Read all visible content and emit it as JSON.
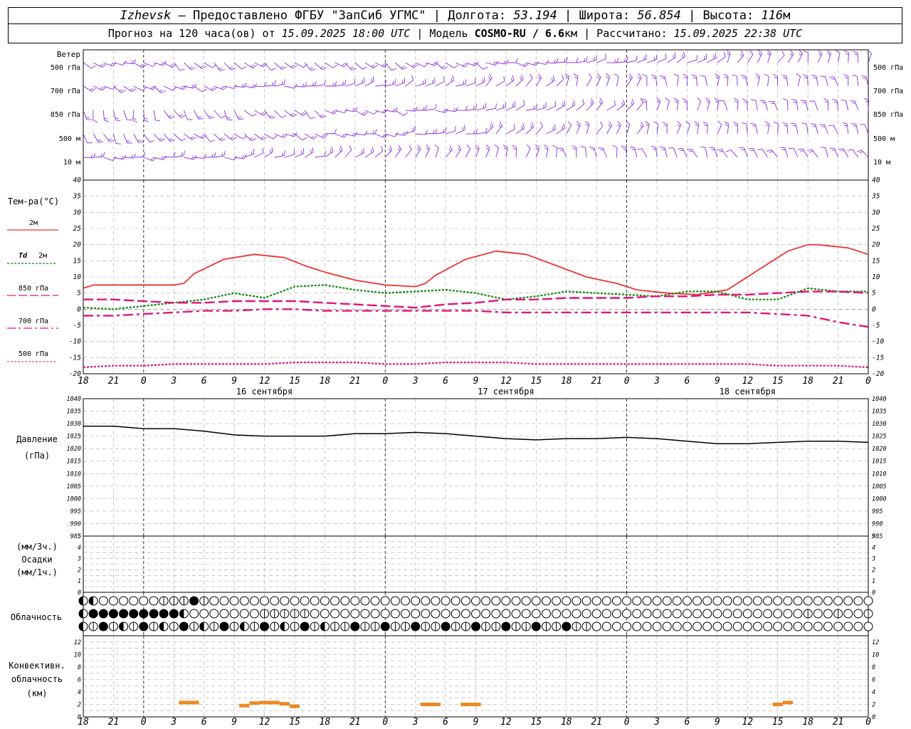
{
  "header": {
    "city": "Izhevsk",
    "provider": "– Предоставлено ФГБУ \"ЗапСиб УГМС\" |",
    "lon_label": "Долгота:",
    "lon": "53.194",
    "lat_label": "| Широта:",
    "lat": "56.854",
    "alt_label": "| Высота:",
    "alt": "116",
    "alt_unit": "м",
    "forecast_prefix": "Прогноз на 120 часа(ов) от",
    "forecast_time": "15.09.2025 18:00 UTC",
    "model_label": "| Модель",
    "model": "COSMO-RU / 6.6",
    "model_unit": "км",
    "calc_label": "| Рассчитано:",
    "calc_time": "15.09.2025 22:38 UTC"
  },
  "labels": {
    "wind": "Ветер",
    "lev500": "500 гПа",
    "lev700": "700 гПа",
    "lev850": "850 гПа",
    "lev500m": "500 м",
    "lev10m": "10  м",
    "temp": "Тем-ра(°C)",
    "t2m": "2м",
    "td": "Td",
    "td_lvl": "2м",
    "t850": "850 гПа",
    "t700": "700 гПа",
    "t500": "500 гПа",
    "pressure1": "Давление",
    "pressure2": "(гПа)",
    "precip1": "(мм/3ч.)",
    "precip2": "Осадки",
    "precip3": "(мм/1ч.)",
    "cloud": "Облачность",
    "conv1": "Конвективн.",
    "conv2": "облачность",
    "conv3": "(км)"
  },
  "colors": {
    "t2m": "#ee3333",
    "td": "#118811",
    "t850": "#e0157a",
    "t700": "#e0157a",
    "t500": "#e0157a",
    "wind": "#8a2be2",
    "pressure": "#000000",
    "conv": "#ee8822",
    "grid": "#aaaaaa"
  },
  "chart_data": [
    {
      "type": "line",
      "panel": "temperature",
      "ylim": [
        -20,
        40
      ],
      "yticks": [
        -20,
        -15,
        -10,
        -5,
        0,
        5,
        10,
        15,
        20,
        25,
        30,
        35,
        40
      ],
      "x_hours_from_start": [
        0,
        3,
        6,
        9,
        12,
        15,
        18,
        21,
        24,
        27,
        30,
        33,
        36,
        39,
        42,
        45,
        48,
        51,
        54,
        57,
        60,
        63,
        66,
        69,
        72,
        75,
        78
      ],
      "x_tick_labels": [
        "18",
        "21",
        "0",
        "3",
        "6",
        "9",
        "12",
        "15",
        "18",
        "21",
        "0",
        "3",
        "6",
        "9",
        "12",
        "15",
        "18",
        "21",
        "0",
        "3",
        "6",
        "9",
        "12",
        "15",
        "18",
        "21",
        "0"
      ],
      "day_labels": [
        {
          "hour": 18,
          "text": "16 сентября"
        },
        {
          "hour": 42,
          "text": "17 сентября"
        },
        {
          "hour": 66,
          "text": "18 сентября"
        }
      ],
      "series": [
        {
          "name": "2м",
          "x": [
            0,
            1,
            3,
            6,
            9,
            10,
            11,
            14,
            17,
            20,
            22,
            24,
            27,
            30,
            33,
            34,
            35,
            38,
            41,
            44,
            47,
            50,
            53,
            54,
            55,
            58,
            61,
            64,
            67,
            70,
            72,
            73,
            76,
            78
          ],
          "values": [
            6.5,
            7.5,
            7.5,
            7.5,
            7.5,
            8,
            11,
            15.5,
            17,
            16,
            13.5,
            11.5,
            9,
            7.5,
            7,
            8,
            10.5,
            15.5,
            18,
            17,
            13.5,
            10,
            8,
            7,
            6,
            5,
            4.5,
            6,
            12,
            18,
            20,
            20,
            19,
            17
          ]
        },
        {
          "name": "Td 2м",
          "x": [
            0,
            3,
            6,
            9,
            12,
            15,
            18,
            21,
            24,
            27,
            30,
            33,
            36,
            39,
            42,
            45,
            48,
            51,
            54,
            57,
            60,
            63,
            66,
            69,
            72,
            75,
            78
          ],
          "values": [
            0.5,
            0,
            1,
            2,
            3,
            5,
            3.5,
            7,
            7.5,
            6,
            5,
            5.5,
            6,
            5,
            3,
            4,
            5.5,
            5,
            4.5,
            4,
            5.5,
            5.5,
            3,
            3,
            6.5,
            5.5,
            5.5
          ]
        },
        {
          "name": "850 гПа",
          "x": [
            0,
            3,
            6,
            9,
            12,
            15,
            18,
            21,
            24,
            27,
            30,
            33,
            36,
            39,
            42,
            45,
            48,
            51,
            54,
            57,
            60,
            63,
            66,
            69,
            72,
            75,
            78
          ],
          "values": [
            3,
            3,
            2.5,
            2,
            2,
            2.5,
            2.5,
            2.5,
            2,
            1.5,
            1,
            0.5,
            1.5,
            2,
            3,
            3,
            3.5,
            3.5,
            3.5,
            4,
            4,
            4.5,
            4.5,
            5,
            5.5,
            5.5,
            5
          ]
        },
        {
          "name": "700 гПа",
          "x": [
            0,
            3,
            6,
            9,
            12,
            15,
            18,
            21,
            24,
            27,
            30,
            33,
            36,
            39,
            42,
            45,
            48,
            51,
            54,
            57,
            60,
            63,
            66,
            69,
            72,
            75,
            78
          ],
          "values": [
            -2,
            -2,
            -1.5,
            -1,
            -0.5,
            -0.5,
            0,
            0,
            -0.5,
            -0.5,
            -0.5,
            -0.5,
            -0.5,
            -0.5,
            -1,
            -1,
            -1,
            -1,
            -1,
            -1,
            -1,
            -1,
            -1,
            -1.5,
            -2,
            -4,
            -5.5
          ]
        },
        {
          "name": "500 гПа",
          "x": [
            0,
            3,
            6,
            9,
            12,
            15,
            18,
            21,
            24,
            27,
            30,
            33,
            36,
            39,
            42,
            45,
            48,
            51,
            54,
            57,
            60,
            63,
            66,
            69,
            72,
            75,
            78
          ],
          "values": [
            -18,
            -17.5,
            -17.5,
            -17,
            -17,
            -17,
            -17,
            -16.5,
            -16.5,
            -16.5,
            -17,
            -17,
            -16.5,
            -16.5,
            -16.5,
            -17,
            -17,
            -17,
            -17,
            -17,
            -17,
            -17,
            -17,
            -17.5,
            -17.5,
            -17.5,
            -18
          ]
        }
      ]
    },
    {
      "type": "line",
      "panel": "pressure",
      "ylim": [
        985,
        1040
      ],
      "yticks": [
        985,
        990,
        995,
        1000,
        1005,
        1010,
        1015,
        1020,
        1025,
        1030,
        1035,
        1040
      ],
      "series": [
        {
          "name": "Давление",
          "x": [
            0,
            3,
            6,
            9,
            12,
            15,
            18,
            21,
            24,
            27,
            30,
            33,
            36,
            39,
            42,
            45,
            48,
            51,
            54,
            57,
            60,
            63,
            66,
            69,
            72,
            75,
            78
          ],
          "values": [
            1029,
            1029,
            1028,
            1028,
            1027,
            1025.5,
            1025,
            1025,
            1025,
            1026,
            1026,
            1026.5,
            1026,
            1025,
            1024,
            1023.5,
            1024,
            1024,
            1024.5,
            1024,
            1023,
            1022,
            1022,
            1022.5,
            1023,
            1023,
            1022.5
          ]
        }
      ]
    },
    {
      "type": "bar",
      "panel": "precipitation",
      "ylim": [
        0,
        5
      ],
      "yticks": [
        0,
        1,
        2,
        3,
        4,
        5
      ],
      "series": []
    },
    {
      "type": "bar",
      "panel": "convective-cloud",
      "ylim": [
        0,
        13
      ],
      "yticks": [
        0,
        2,
        4,
        6,
        8,
        10,
        12
      ],
      "segments": [
        {
          "x0": 9.5,
          "x1": 11.5,
          "y": 2.3
        },
        {
          "x0": 15.5,
          "x1": 16.5,
          "y": 1.8
        },
        {
          "x0": 16.5,
          "x1": 17.5,
          "y": 2.2
        },
        {
          "x0": 17.5,
          "x1": 19.5,
          "y": 2.3
        },
        {
          "x0": 19.5,
          "x1": 20.5,
          "y": 2.1
        },
        {
          "x0": 20.5,
          "x1": 21.5,
          "y": 1.7
        },
        {
          "x0": 33.5,
          "x1": 35.5,
          "y": 2.0
        },
        {
          "x0": 37.5,
          "x1": 39.5,
          "y": 2.0
        },
        {
          "x0": 68.5,
          "x1": 69.5,
          "y": 2.0
        },
        {
          "x0": 69.5,
          "x1": 70.5,
          "y": 2.3
        }
      ]
    }
  ]
}
